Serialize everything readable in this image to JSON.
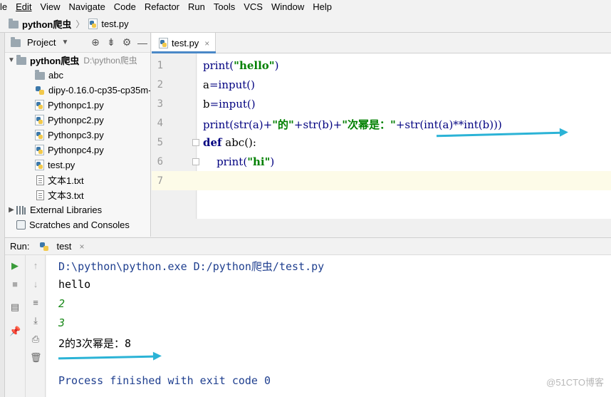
{
  "menu": [
    "le",
    "Edit",
    "View",
    "Navigate",
    "Code",
    "Refactor",
    "Run",
    "Tools",
    "VCS",
    "Window",
    "Help"
  ],
  "breadcrumb": {
    "project": "python爬虫",
    "separator": "〉",
    "file": "test.py"
  },
  "project_panel": {
    "title": "Project",
    "root": {
      "name": "python爬虫",
      "path": "D:\\python爬虫"
    },
    "items": [
      {
        "name": "abc",
        "icon": "folder-icon"
      },
      {
        "name": "dipy-0.16.0-cp35-cp35m-",
        "icon": "python-package-icon"
      },
      {
        "name": "Pythonpc1.py",
        "icon": "python-file-icon"
      },
      {
        "name": "Pythonpc2.py",
        "icon": "python-file-icon"
      },
      {
        "name": "Pythonpc3.py",
        "icon": "python-file-icon"
      },
      {
        "name": "Pythonpc4.py",
        "icon": "python-file-icon"
      },
      {
        "name": "test.py",
        "icon": "python-file-icon"
      },
      {
        "name": "文本1.txt",
        "icon": "text-file-icon"
      },
      {
        "name": "文本3.txt",
        "icon": "text-file-icon"
      }
    ],
    "external_libraries": "External Libraries",
    "scratches": "Scratches and Consoles"
  },
  "editor": {
    "tab": "test.py",
    "line_numbers": [
      "1",
      "2",
      "3",
      "4",
      "5",
      "6",
      "7"
    ],
    "lines": {
      "l1": {
        "a": "print(",
        "b": "\"hello\"",
        "c": ")"
      },
      "l2": {
        "a": "a",
        "b": "=input()"
      },
      "l3": {
        "a": "b",
        "b": "=input()"
      },
      "l4": {
        "a": "print(str(a)+",
        "b": "\"的\"",
        "c": "+str(b)+",
        "d": "\"次幂是：\"",
        "e": "+str(int(a)**int(b)))"
      },
      "l5": {
        "a": "def",
        "b": " abc():"
      },
      "l6": {
        "a": "    print(",
        "b": "\"hi\"",
        "c": ")"
      }
    }
  },
  "run": {
    "label": "Run:",
    "tab": "test",
    "console": {
      "cmd": "D:\\python\\python.exe D:/python爬虫/test.py",
      "out1": "hello",
      "in1": "2",
      "in2": "3",
      "out2": "2的3次幂是：8",
      "exit": "Process finished with exit code 0"
    }
  },
  "watermark": "@51CTO博客",
  "colors": {
    "annotation_arrow": "#2bb3d6",
    "string": "#008000",
    "keyword": "#000080"
  }
}
